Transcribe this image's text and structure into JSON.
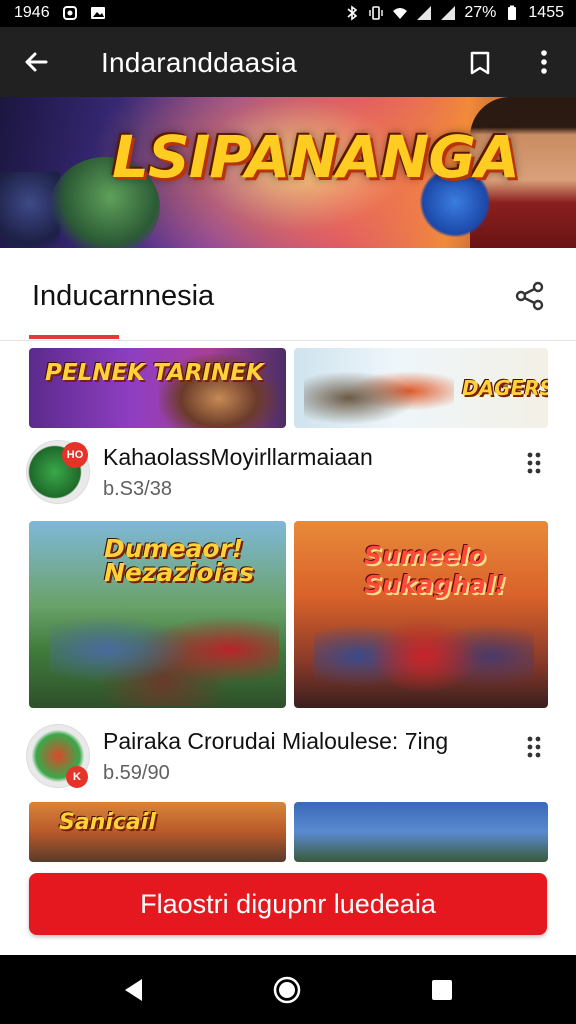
{
  "status_bar": {
    "time": "1946",
    "battery": "27%",
    "time_right": "1455"
  },
  "app_bar": {
    "title": "Indaranddaasia"
  },
  "banner": {
    "title": "LSIPANANGA"
  },
  "section": {
    "title": "Inducarnnesia"
  },
  "thumbnails": {
    "t1_text": "PELNEK TARINEK",
    "t2_text": "DAGERS",
    "t3_text": "Dumeaor! Nezazioias",
    "t4_text": "Sumeelo Sukaghal!",
    "t5_text": "Sanicail"
  },
  "channels": [
    {
      "title": "KahaolassMoyirllarmaiaan",
      "subtitle": "b.S3/38",
      "badge": "HO"
    },
    {
      "title": "Pairaka Crorudai Mialoulese: 7ing",
      "subtitle": "b.59/90",
      "badge": "K"
    }
  ],
  "cta": {
    "label": "Flaostri digupnr luedeaia"
  },
  "colors": {
    "accent": "#e4181e",
    "app_bar": "#212121"
  },
  "icons": [
    "wifi-icon",
    "signal-icon",
    "battery-icon",
    "bluetooth-icon",
    "back-arrow-icon",
    "bookmark-icon",
    "more-vert-icon",
    "share-icon",
    "kebab-icon",
    "nav-back-icon",
    "nav-home-icon",
    "nav-recents-icon"
  ]
}
